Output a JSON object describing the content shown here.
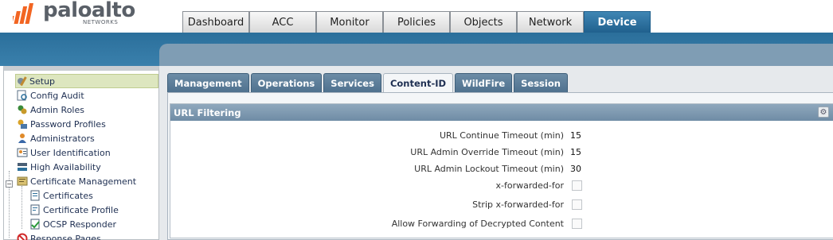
{
  "header": {
    "logo_text": "paloalto",
    "logo_sub": "NETWORKS",
    "tabs": [
      {
        "label": "Dashboard",
        "active": false
      },
      {
        "label": "ACC",
        "active": false
      },
      {
        "label": "Monitor",
        "active": false
      },
      {
        "label": "Policies",
        "active": false
      },
      {
        "label": "Objects",
        "active": false
      },
      {
        "label": "Network",
        "active": false
      },
      {
        "label": "Device",
        "active": true
      }
    ]
  },
  "sidebar": {
    "items": [
      {
        "label": "Setup",
        "icon": "setup-icon",
        "selected": true
      },
      {
        "label": "Config Audit",
        "icon": "config-audit-icon"
      },
      {
        "label": "Admin Roles",
        "icon": "admin-roles-icon"
      },
      {
        "label": "Password Profiles",
        "icon": "password-profiles-icon"
      },
      {
        "label": "Administrators",
        "icon": "administrators-icon"
      },
      {
        "label": "User Identification",
        "icon": "user-identification-icon"
      },
      {
        "label": "High Availability",
        "icon": "high-availability-icon"
      },
      {
        "label": "Certificate Management",
        "icon": "certificate-management-icon",
        "expanded": true
      },
      {
        "label": "Certificates",
        "icon": "certificate-icon",
        "child": true
      },
      {
        "label": "Certificate Profile",
        "icon": "certificate-profile-icon",
        "child": true
      },
      {
        "label": "OCSP Responder",
        "icon": "ocsp-responder-icon",
        "child": true
      },
      {
        "label": "Response Pages",
        "icon": "response-pages-icon"
      }
    ]
  },
  "sub_tabs": [
    {
      "label": "Management",
      "active": false
    },
    {
      "label": "Operations",
      "active": false
    },
    {
      "label": "Services",
      "active": false
    },
    {
      "label": "Content-ID",
      "active": true
    },
    {
      "label": "WildFire",
      "active": false
    },
    {
      "label": "Session",
      "active": false
    }
  ],
  "url_filtering": {
    "title": "URL Filtering",
    "rows": [
      {
        "label": "URL Continue Timeout (min)",
        "value": "15",
        "type": "text"
      },
      {
        "label": "URL Admin Override Timeout (min)",
        "value": "15",
        "type": "text"
      },
      {
        "label": "URL Admin Lockout Timeout (min)",
        "value": "30",
        "type": "text"
      },
      {
        "label": "x-forwarded-for",
        "value": "",
        "type": "checkbox"
      },
      {
        "label": "Strip x-forwarded-for",
        "value": "",
        "type": "checkbox"
      },
      {
        "label": "Allow Forwarding of Decrypted Content",
        "value": "",
        "type": "checkbox"
      }
    ]
  },
  "colors": {
    "accent_blue": "#2b6f9b",
    "section_header": "#7f9db4",
    "selected_row": "#dde6bf"
  }
}
